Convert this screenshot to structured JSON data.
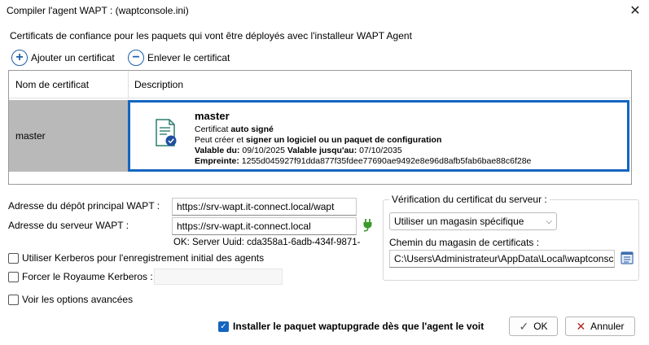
{
  "window": {
    "title": "Compiler l'agent WAPT : (waptconsole.ini)"
  },
  "section_label": "Certificats de confiance pour les paquets qui vont être déployés avec l'installeur WAPT Agent",
  "toolbar": {
    "add_label": "Ajouter un certificat",
    "remove_label": "Enlever le certificat"
  },
  "grid": {
    "columns": [
      "Nom de certificat",
      "Description"
    ],
    "row": {
      "name": "master",
      "title": "master",
      "line1_prefix": "Certificat ",
      "line1_bold": "auto signé",
      "line2_prefix": "Peut créer et ",
      "line2_bold": "signer un logiciel ou un paquet de configuration",
      "valid_from_label": "Valable du:",
      "valid_from": "09/10/2025",
      "valid_to_label": "Valable jusqu'au:",
      "valid_to": "07/10/2035",
      "fingerprint_label": "Empreinte:",
      "fingerprint": "1255d045927f91dda877f35fdee77690ae9492e8e96d8afb5fab6bae88c6f28e"
    }
  },
  "form": {
    "repo_label": "Adresse du dépôt principal WAPT :",
    "repo_value": "https://srv-wapt.it-connect.local/wapt",
    "server_label": "Adresse du serveur WAPT :",
    "server_value": "https://srv-wapt.it-connect.local",
    "server_status": "OK: Server Uuid: cda358a1-6adb-434f-9871-",
    "kerberos_label": "Utiliser Kerberos pour l'enregistrement initial des agents",
    "realm_label": "Forcer le Royaume Kerberos :",
    "advanced_label": "Voir les options avancées",
    "upgrade_label": "Installer le paquet waptupgrade dès que l'agent le voit"
  },
  "verification": {
    "title": "Vérification du certificat du serveur :",
    "selected": "Utiliser un magasin spécifique",
    "path_label": "Chemin du magasin de certificats :",
    "path_value": "C:\\Users\\Administrateur\\AppData\\Local\\waptconsc"
  },
  "buttons": {
    "ok": "OK",
    "cancel": "Annuler"
  },
  "colors": {
    "accent": "#1565c0",
    "selected_row": "#b9b9b9",
    "plug": "#3a9a2a"
  }
}
